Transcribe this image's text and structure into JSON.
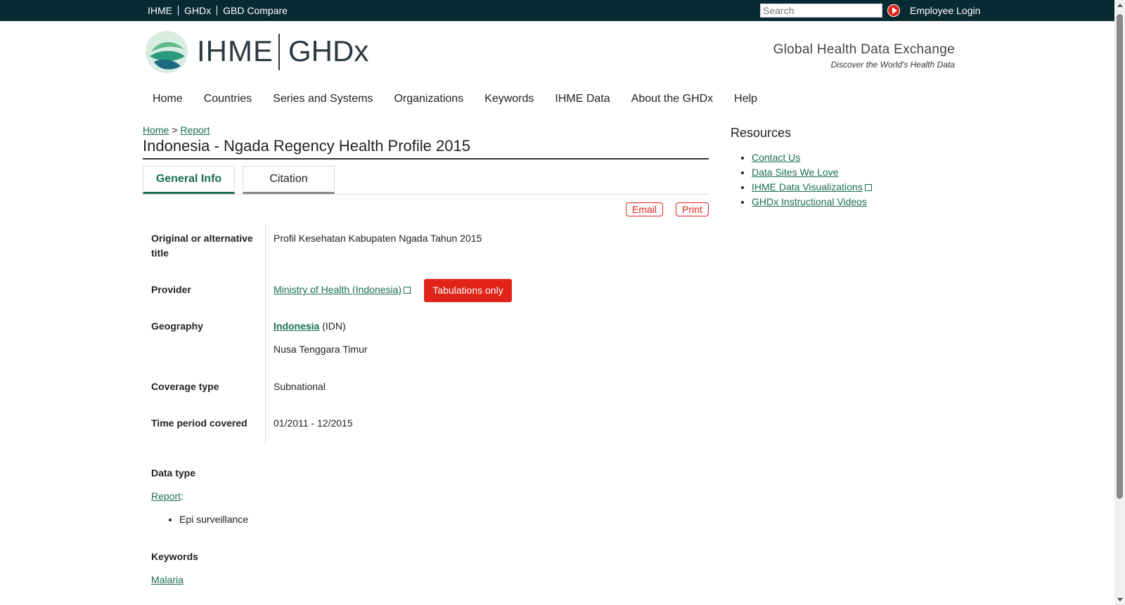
{
  "topbar": {
    "links": [
      "IHME",
      "GHDx",
      "GBD Compare"
    ],
    "search_placeholder": "Search",
    "employee_login": "Employee Login"
  },
  "header": {
    "logo_ihme": "IHME",
    "logo_ghdx": "GHDx",
    "tagline": "Global Health Data Exchange",
    "tagline_sub": "Discover the World's Health Data"
  },
  "nav": [
    "Home",
    "Countries",
    "Series and Systems",
    "Organizations",
    "Keywords",
    "IHME Data",
    "About the GHDx",
    "Help"
  ],
  "breadcrumb": {
    "home": "Home",
    "separator": ">",
    "current": "Report"
  },
  "page_title": "Indonesia - Ngada Regency Health Profile 2015",
  "tabs": {
    "general": "General Info",
    "citation": "Citation"
  },
  "actions": {
    "email": "Email",
    "print": "Print"
  },
  "fields": {
    "alt_title_label": "Original or alternative title",
    "alt_title_value": "Profil Kesehatan Kabupaten Ngada Tahun 2015",
    "provider_label": "Provider",
    "provider_value": "Ministry of Health (Indonesia)",
    "provider_badge": "Tabulations only",
    "geography_label": "Geography",
    "geography_country": "Indonesia",
    "geography_code": "(IDN)",
    "geography_region": "Nusa Tenggara Timur",
    "coverage_label": "Coverage type",
    "coverage_value": "Subnational",
    "time_label": "Time period covered",
    "time_value": "01/2011 - 12/2015",
    "data_type_label": "Data type",
    "data_type_link": "Report",
    "data_type_items": [
      "Epi surveillance"
    ],
    "keywords_label": "Keywords",
    "keywords_items": [
      "Malaria"
    ]
  },
  "sidebar": {
    "title": "Resources",
    "links": [
      "Contact Us",
      "Data Sites We Love",
      "IHME Data Visualizations",
      "GHDx Instructional Videos"
    ]
  },
  "colors": {
    "topbar": "#082a33",
    "accent_green": "#1a6e4f",
    "accent_red": "#e2231a"
  }
}
